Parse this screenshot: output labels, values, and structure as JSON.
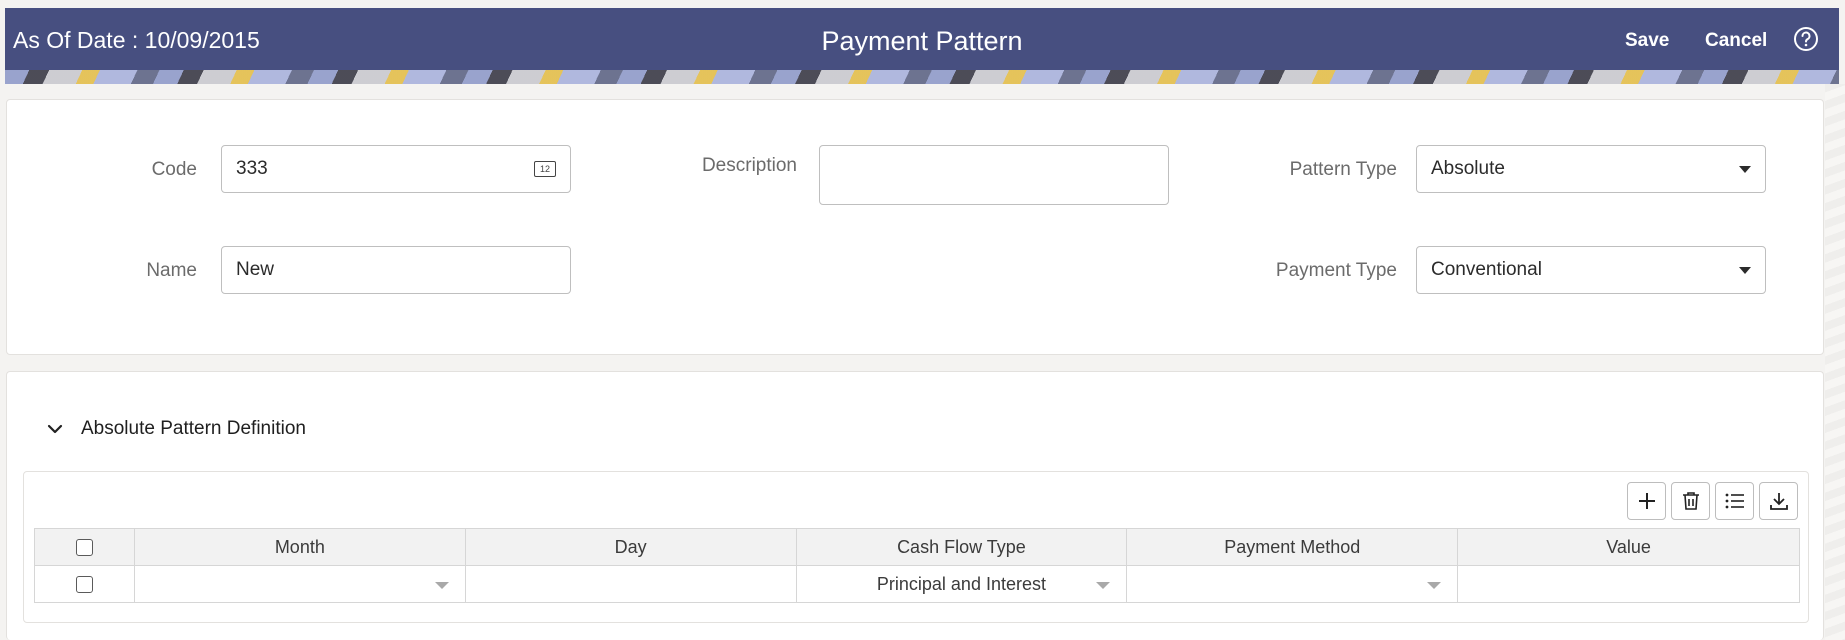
{
  "header": {
    "as_of_date": "As Of Date : 10/09/2015",
    "title": "Payment Pattern",
    "save_label": "Save",
    "cancel_label": "Cancel",
    "help_icon": "help-circle-icon"
  },
  "form": {
    "code_label": "Code",
    "code_value": "333",
    "code_icon": "calculator-icon",
    "description_label": "Description",
    "description_value": "",
    "pattern_type_label": "Pattern Type",
    "pattern_type_value": "Absolute",
    "name_label": "Name",
    "name_value": "New",
    "payment_type_label": "Payment Type",
    "payment_type_value": "Conventional"
  },
  "section": {
    "title": "Absolute Pattern Definition",
    "expanded": true
  },
  "toolbar": {
    "icons": [
      "add-icon",
      "delete-icon",
      "list-icon",
      "download-icon"
    ]
  },
  "table": {
    "columns": [
      "Month",
      "Day",
      "Cash Flow Type",
      "Payment Method",
      "Value"
    ],
    "rows": [
      {
        "month": "",
        "day": "",
        "cash_flow_type": "Principal and Interest",
        "payment_method": "",
        "value": ""
      }
    ]
  },
  "colors": {
    "header_bg": "#474f80",
    "panel_bg": "#ffffff",
    "page_bg": "#f4f3f1"
  }
}
